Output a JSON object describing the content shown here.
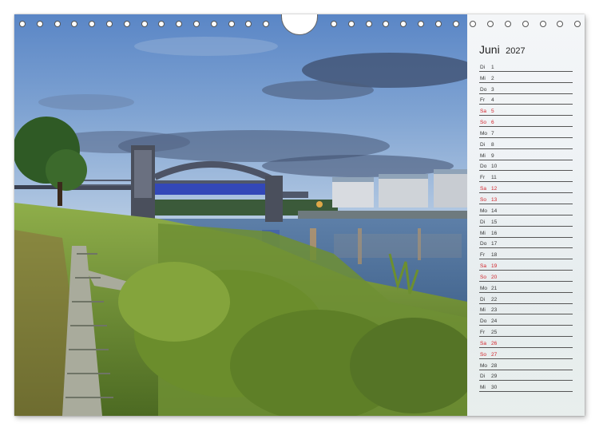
{
  "calendar": {
    "month": "Juni",
    "year": "2027",
    "days": [
      {
        "dow": "Di",
        "day": "1"
      },
      {
        "dow": "Mi",
        "day": "2"
      },
      {
        "dow": "Do",
        "day": "3"
      },
      {
        "dow": "Fr",
        "day": "4"
      },
      {
        "dow": "Sa",
        "day": "5",
        "weekend": true
      },
      {
        "dow": "So",
        "day": "6",
        "weekend": true
      },
      {
        "dow": "Mo",
        "day": "7"
      },
      {
        "dow": "Di",
        "day": "8"
      },
      {
        "dow": "Mi",
        "day": "9"
      },
      {
        "dow": "Do",
        "day": "10"
      },
      {
        "dow": "Fr",
        "day": "11"
      },
      {
        "dow": "Sa",
        "day": "12",
        "weekend": true
      },
      {
        "dow": "So",
        "day": "13",
        "weekend": true
      },
      {
        "dow": "Mo",
        "day": "14"
      },
      {
        "dow": "Di",
        "day": "15"
      },
      {
        "dow": "Mi",
        "day": "16"
      },
      {
        "dow": "Do",
        "day": "17"
      },
      {
        "dow": "Fr",
        "day": "18"
      },
      {
        "dow": "Sa",
        "day": "19",
        "weekend": true
      },
      {
        "dow": "So",
        "day": "20",
        "weekend": true
      },
      {
        "dow": "Mo",
        "day": "21"
      },
      {
        "dow": "Di",
        "day": "22"
      },
      {
        "dow": "Mi",
        "day": "23"
      },
      {
        "dow": "Do",
        "day": "24"
      },
      {
        "dow": "Fr",
        "day": "25"
      },
      {
        "dow": "Sa",
        "day": "26",
        "weekend": true
      },
      {
        "dow": "So",
        "day": "27",
        "weekend": true
      },
      {
        "dow": "Mo",
        "day": "28"
      },
      {
        "dow": "Di",
        "day": "29"
      },
      {
        "dow": "Mi",
        "day": "30"
      }
    ]
  },
  "colors": {
    "weekend": "#d2232a",
    "weekday": "#333333",
    "sky_top": "#5d88c4",
    "water": "#4a6f9a",
    "grass": "#7e9a3e"
  },
  "icons": {
    "binding": "spiral-binding-rings",
    "hanger": "wall-hanger-notch"
  }
}
